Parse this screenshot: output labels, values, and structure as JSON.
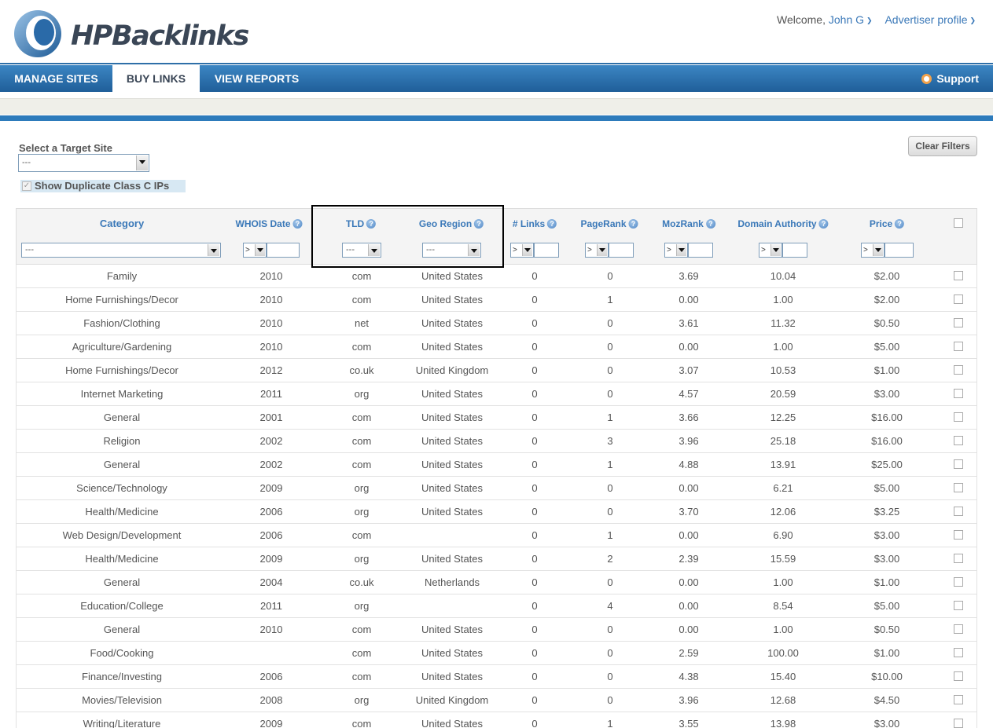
{
  "header": {
    "logo_text": "HPBacklinks",
    "welcome_prefix": "Welcome,",
    "user_name": "John G",
    "advertiser_profile": "Advertiser profile"
  },
  "nav": {
    "items": [
      {
        "label": "MANAGE SITES",
        "active": false
      },
      {
        "label": "BUY LINKS",
        "active": true
      },
      {
        "label": "VIEW REPORTS",
        "active": false
      }
    ],
    "support": "Support"
  },
  "controls": {
    "target_label": "Select a Target Site",
    "target_value": "---",
    "duplicate_label": "Show Duplicate Class C IPs",
    "duplicate_checked": true,
    "clear_filters": "Clear Filters"
  },
  "table": {
    "columns": [
      "Category",
      "WHOIS Date",
      "TLD",
      "Geo Region",
      "# Links",
      "PageRank",
      "MozRank",
      "Domain Authority",
      "Price"
    ],
    "filters": {
      "category": "---",
      "tld": "---",
      "geo_region": "---",
      "operator": ">"
    },
    "rows": [
      [
        "Family",
        "2010",
        "com",
        "United States",
        "0",
        "0",
        "3.69",
        "10.04",
        "$2.00"
      ],
      [
        "Home Furnishings/Decor",
        "2010",
        "com",
        "United States",
        "0",
        "1",
        "0.00",
        "1.00",
        "$2.00"
      ],
      [
        "Fashion/Clothing",
        "2010",
        "net",
        "United States",
        "0",
        "0",
        "3.61",
        "11.32",
        "$0.50"
      ],
      [
        "Agriculture/Gardening",
        "2010",
        "com",
        "United States",
        "0",
        "0",
        "0.00",
        "1.00",
        "$5.00"
      ],
      [
        "Home Furnishings/Decor",
        "2012",
        "co.uk",
        "United Kingdom",
        "0",
        "0",
        "3.07",
        "10.53",
        "$1.00"
      ],
      [
        "Internet Marketing",
        "2011",
        "org",
        "United States",
        "0",
        "0",
        "4.57",
        "20.59",
        "$3.00"
      ],
      [
        "General",
        "2001",
        "com",
        "United States",
        "0",
        "1",
        "3.66",
        "12.25",
        "$16.00"
      ],
      [
        "Religion",
        "2002",
        "com",
        "United States",
        "0",
        "3",
        "3.96",
        "25.18",
        "$16.00"
      ],
      [
        "General",
        "2002",
        "com",
        "United States",
        "0",
        "1",
        "4.88",
        "13.91",
        "$25.00"
      ],
      [
        "Science/Technology",
        "2009",
        "org",
        "United States",
        "0",
        "0",
        "0.00",
        "6.21",
        "$5.00"
      ],
      [
        "Health/Medicine",
        "2006",
        "org",
        "United States",
        "0",
        "0",
        "3.70",
        "12.06",
        "$3.25"
      ],
      [
        "Web Design/Development",
        "2006",
        "com",
        "",
        "0",
        "1",
        "0.00",
        "6.90",
        "$3.00"
      ],
      [
        "Health/Medicine",
        "2009",
        "org",
        "United States",
        "0",
        "2",
        "2.39",
        "15.59",
        "$3.00"
      ],
      [
        "General",
        "2004",
        "co.uk",
        "Netherlands",
        "0",
        "0",
        "0.00",
        "1.00",
        "$1.00"
      ],
      [
        "Education/College",
        "2011",
        "org",
        "",
        "0",
        "4",
        "0.00",
        "8.54",
        "$5.00"
      ],
      [
        "General",
        "2010",
        "com",
        "United States",
        "0",
        "0",
        "0.00",
        "1.00",
        "$0.50"
      ],
      [
        "Food/Cooking",
        "",
        "com",
        "United States",
        "0",
        "0",
        "2.59",
        "100.00",
        "$1.00"
      ],
      [
        "Finance/Investing",
        "2006",
        "com",
        "United States",
        "0",
        "0",
        "4.38",
        "15.40",
        "$10.00"
      ],
      [
        "Movies/Television",
        "2008",
        "org",
        "United Kingdom",
        "0",
        "0",
        "3.96",
        "12.68",
        "$4.50"
      ],
      [
        "Writing/Literature",
        "2009",
        "com",
        "United States",
        "0",
        "1",
        "3.55",
        "13.98",
        "$3.00"
      ]
    ]
  }
}
